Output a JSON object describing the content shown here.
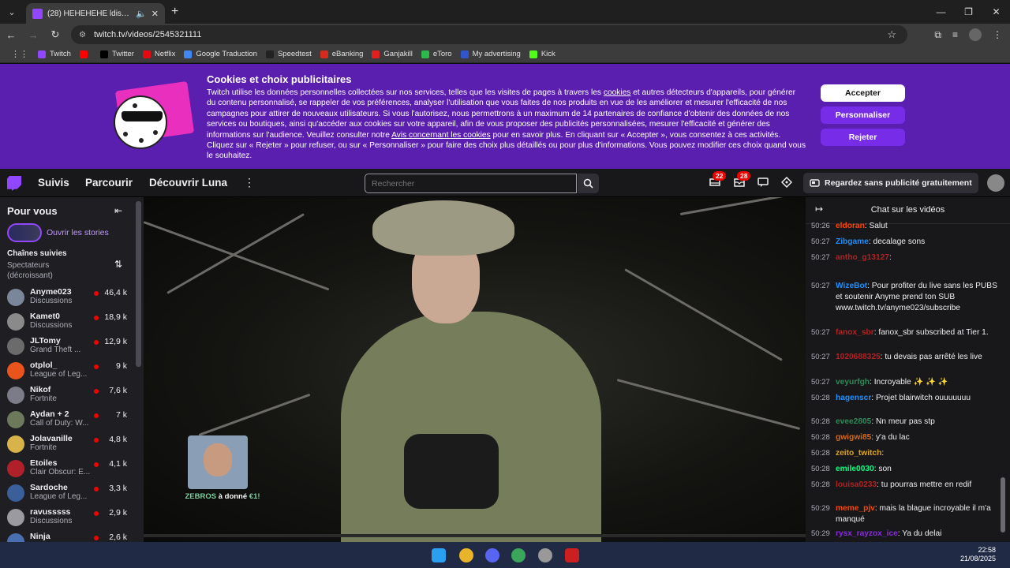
{
  "browser": {
    "tab_title": "(28) HEHEHEHE ldiscord ld...",
    "url": "twitch.tv/videos/2545321111",
    "bookmarks": [
      {
        "label": "Twitch",
        "color": "#9146ff"
      },
      {
        "label": "",
        "color": "#ff0000"
      },
      {
        "label": "Twitter",
        "color": "#000000"
      },
      {
        "label": "Netflix",
        "color": "#e50914"
      },
      {
        "label": "Google Traduction",
        "color": "#4285f4"
      },
      {
        "label": "Speedtest",
        "color": "#222222"
      },
      {
        "label": "eBanking",
        "color": "#d52b1e"
      },
      {
        "label": "Ganjakill",
        "color": "#e02020"
      },
      {
        "label": "eToro",
        "color": "#2db84b"
      },
      {
        "label": "My advertising",
        "color": "#3355cc"
      },
      {
        "label": "Kick",
        "color": "#53fc18"
      }
    ]
  },
  "cookie": {
    "title": "Cookies et choix publicitaires",
    "text_1": "Twitch utilise les données personnelles collectées sur nos services, telles que les visites de pages à travers les ",
    "link_cookies": "cookies",
    "text_2": " et autres détecteurs d'appareils, pour générer du contenu personnalisé, se rappeler de vos préférences, analyser l'utilisation que vous faites de nos produits en vue de les améliorer et mesurer l'efficacité de nos campagnes pour attirer de nouveaux utilisateurs. Si vous l'autorisez, nous permettrons à un maximum de 14 partenaires de confiance d'obtenir des données de nos services ou boutiques, ainsi qu'accéder aux cookies sur votre appareil, afin de vous proposer des publicités personnalisées, mesurer l'efficacité et générer des informations sur l'audience. Veuillez consulter notre ",
    "link_notice": "Avis concernant les cookies",
    "text_3": " pour en savoir plus. En cliquant sur « Accepter », vous consentez à ces activités. Cliquez sur « Rejeter » pour refuser, ou sur « Personnaliser » pour faire des choix plus détaillés ou pour plus d'informations. Vous pouvez modifier ces choix quand vous le souhaitez.",
    "accept": "Accepter",
    "customize": "Personnaliser",
    "reject": "Rejeter"
  },
  "topnav": {
    "follow": "Suivis",
    "browse": "Parcourir",
    "luna": "Découvrir Luna",
    "search_placeholder": "Rechercher",
    "notif_count": "22",
    "inbox_count": "28",
    "adfree": "Regardez sans publicité gratuitement"
  },
  "sidebar": {
    "title": "Pour vous",
    "stories": "Ouvrir les stories",
    "followed": "Chaînes suivies",
    "sort": "Spectateurs (décroissant)",
    "channels": [
      {
        "name": "Anyme023",
        "game": "Discussions",
        "viewers": "46,4 k",
        "color": "#7a8699"
      },
      {
        "name": "Kamet0",
        "game": "Discussions",
        "viewers": "18,9 k",
        "color": "#8a8a8a"
      },
      {
        "name": "JLTomy",
        "game": "Grand Theft ...",
        "viewers": "12,9 k",
        "color": "#6b6b6b"
      },
      {
        "name": "otplol_",
        "game": "League of Leg...",
        "viewers": "9 k",
        "color": "#e8541c"
      },
      {
        "name": "Nikof",
        "game": "Fortnite",
        "viewers": "7,6 k",
        "color": "#7c7c88"
      },
      {
        "name": "Aydan + 2",
        "game": "Call of Duty: W...",
        "viewers": "7 k",
        "color": "#6a7a5a"
      },
      {
        "name": "Jolavanille",
        "game": "Fortnite",
        "viewers": "4,8 k",
        "color": "#d8b34a"
      },
      {
        "name": "Etoiles",
        "game": "Clair Obscur: E...",
        "viewers": "4,1 k",
        "color": "#b0202a"
      },
      {
        "name": "Sardoche",
        "game": "League of Leg...",
        "viewers": "3,3 k",
        "color": "#3a5f9a"
      },
      {
        "name": "ravusssss",
        "game": "Discussions",
        "viewers": "2,9 k",
        "color": "#9a9aa0"
      },
      {
        "name": "Ninja",
        "game": "",
        "viewers": "2,6 k",
        "color": "#4a6fb0"
      }
    ]
  },
  "video": {
    "alert_user": "ZEBROS",
    "alert_text": " à donné ",
    "alert_amount": "€1!"
  },
  "chat": {
    "title": "Chat sur les vidéos",
    "messages": [
      {
        "time": "50:26",
        "user": "eldoran",
        "color": "#ff4500",
        "text": ": Salut"
      },
      {
        "time": "50:27",
        "user": "Zibgame",
        "color": "#1e90ff",
        "text": ": decalage sons"
      },
      {
        "time": "50:27",
        "user": "antho_g13127",
        "color": "#b22222",
        "text": ":"
      },
      {
        "time": "50:27",
        "user": "WizeBot",
        "color": "#1e90ff",
        "text": ": Pour profiter du live sans les PUBS et soutenir Anyme prend ton SUB www.twitch.tv/anyme023/subscribe"
      },
      {
        "time": "50:27",
        "user": "fanox_sbr",
        "color": "#b22222",
        "text": ": fanox_sbr subscribed at Tier 1."
      },
      {
        "time": "50:27",
        "user": "1020688325",
        "color": "#b22222",
        "text": ": tu devais pas arrêté les live"
      },
      {
        "time": "50:27",
        "user": "veyurfgh",
        "color": "#2e8b57",
        "text": ": Incroyable ✨ ✨ ✨"
      },
      {
        "time": "50:28",
        "user": "hagenscr",
        "color": "#1e90ff",
        "text": ": Projet blairwitch ouuuuuuu"
      },
      {
        "time": "50:28",
        "user": "evee2805",
        "color": "#2e8b57",
        "text": ": Nn meur pas stp"
      },
      {
        "time": "50:28",
        "user": "gwigwi85",
        "color": "#d2691e",
        "text": ": y'a du lac"
      },
      {
        "time": "50:28",
        "user": "zeito_twitch",
        "color": "#daa520",
        "text": ":"
      },
      {
        "time": "50:28",
        "user": "emile0030",
        "color": "#00ff7f",
        "text": ": son"
      },
      {
        "time": "50:28",
        "user": "louisa0233",
        "color": "#b22222",
        "text": ": tu pourras mettre en redif"
      },
      {
        "time": "50:29",
        "user": "meme_pjv",
        "color": "#ff4500",
        "text": ": mais la blague incroyable il m'a manqué"
      },
      {
        "time": "50:29",
        "user": "rysx_rayzox_ice",
        "color": "#8a2be2",
        "text": ": Ya du delai"
      }
    ]
  },
  "taskbar": {
    "time": "22:58",
    "date": "21/08/2025"
  }
}
